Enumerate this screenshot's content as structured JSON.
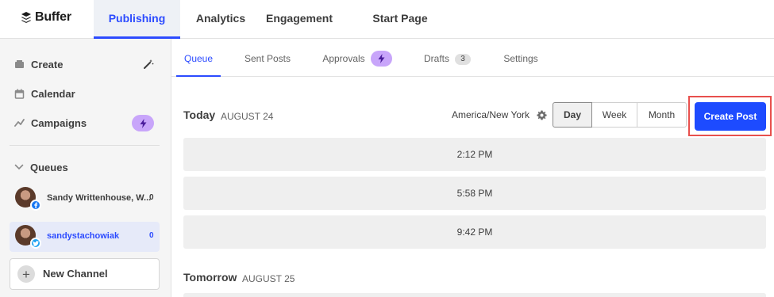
{
  "brand": {
    "name": "Buffer"
  },
  "topnav": {
    "tabs": [
      {
        "label": "Publishing"
      },
      {
        "label": "Analytics"
      },
      {
        "label": "Engagement"
      },
      {
        "label": "Start Page"
      }
    ],
    "active_tab": "Publishing"
  },
  "sidebar": {
    "items": [
      {
        "label": "Create",
        "icon": "create-icon"
      },
      {
        "label": "Calendar",
        "icon": "calendar-icon"
      },
      {
        "label": "Campaigns",
        "icon": "campaigns-icon"
      }
    ],
    "queues_label": "Queues",
    "channels": [
      {
        "name": "Sandy Writtenhouse, W...",
        "network": "facebook",
        "count": "0"
      },
      {
        "name": "sandystachowiak",
        "network": "twitter",
        "count": "0"
      }
    ],
    "new_channel_label": "New Channel"
  },
  "subtabs": {
    "items": [
      {
        "label": "Queue"
      },
      {
        "label": "Sent Posts"
      },
      {
        "label": "Approvals"
      },
      {
        "label": "Drafts"
      },
      {
        "label": "Settings"
      }
    ],
    "drafts_count": "3",
    "active": "Queue"
  },
  "queue": {
    "today": {
      "title": "Today",
      "date": "AUGUST 24"
    },
    "tomorrow": {
      "title": "Tomorrow",
      "date": "AUGUST 25"
    },
    "timezone": "America/New York",
    "view_options": [
      "Day",
      "Week",
      "Month"
    ],
    "active_view": "Day",
    "create_post_label": "Create Post",
    "slots": [
      "2:12 PM",
      "5:58 PM",
      "9:42 PM"
    ]
  },
  "colors": {
    "accent": "#2c4bff",
    "create_button": "#1d4bff",
    "highlight_outline": "#e8504d",
    "upgrade_pill": "#c8a5fa"
  }
}
